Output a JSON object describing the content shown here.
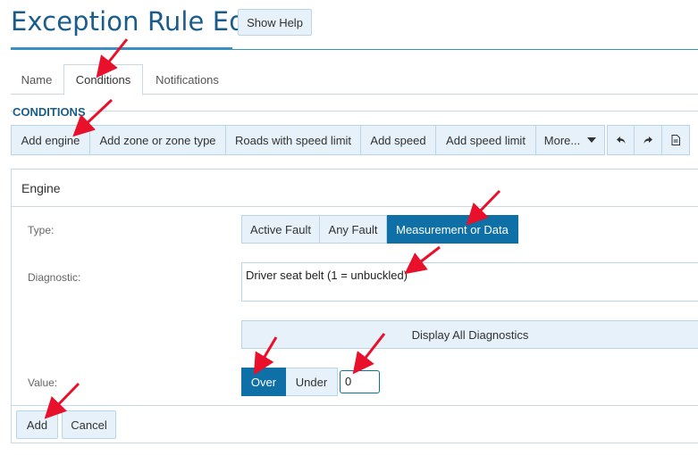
{
  "page": {
    "title": "Exception Rule Edit",
    "show_help_label": "Show Help"
  },
  "tabs": [
    {
      "label": "Name"
    },
    {
      "label": "Conditions",
      "active": true
    },
    {
      "label": "Notifications"
    }
  ],
  "section_label": "CONDITIONS",
  "toolbar": {
    "items": [
      "Add engine",
      "Add zone or zone type",
      "Roads with speed limit",
      "Add speed",
      "Add speed limit",
      "More..."
    ],
    "icons": [
      "undo-icon",
      "redo-icon",
      "document-icon"
    ]
  },
  "panel": {
    "title": "Engine",
    "type_label": "Type:",
    "type_options": [
      "Active Fault",
      "Any Fault",
      "Measurement or Data"
    ],
    "type_selected": "Measurement or Data",
    "diagnostic_label": "Diagnostic:",
    "diagnostic_value": "Driver seat belt (1 = unbuckled)",
    "display_all_label": "Display All Diagnostics",
    "value_label": "Value:",
    "value_options": [
      "Over",
      "Under"
    ],
    "value_selected": "Over",
    "value_input": "0",
    "add_label": "Add",
    "cancel_label": "Cancel"
  },
  "colors": {
    "accent": "#0e70a7",
    "title": "#1a5c8a",
    "button_bg": "#e6f1f9",
    "annotation_arrow": "#e8102a"
  }
}
